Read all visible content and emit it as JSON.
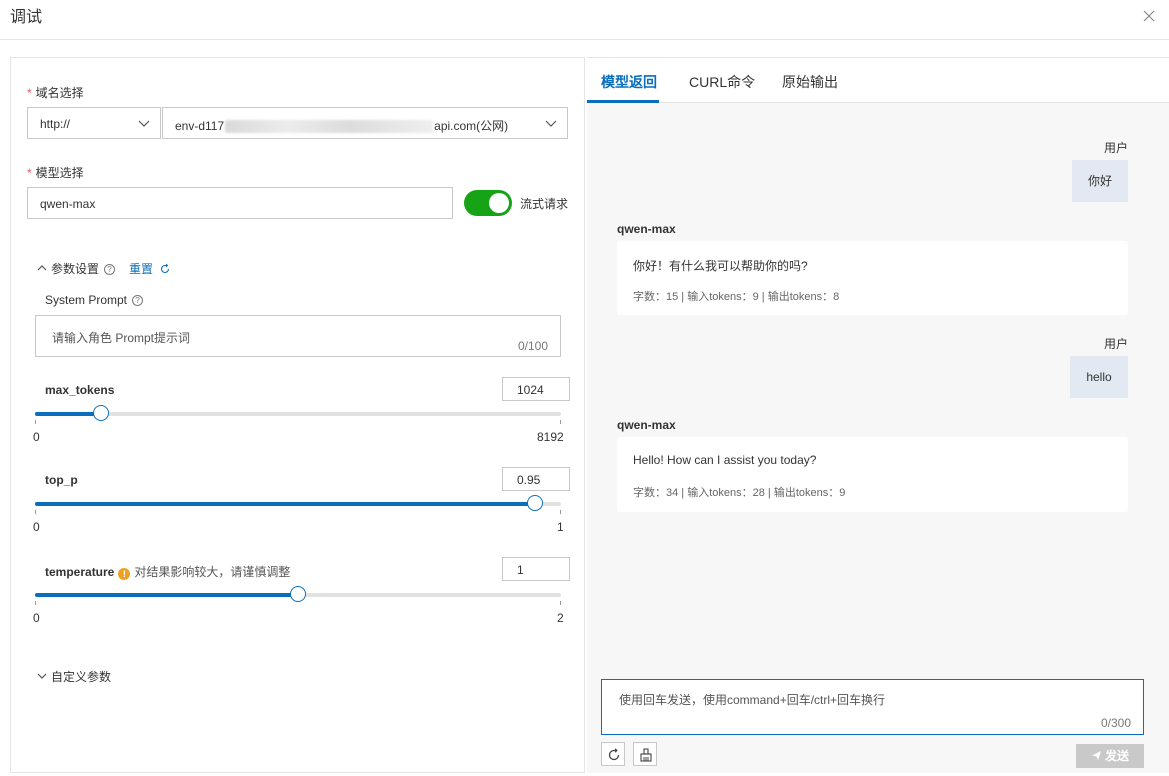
{
  "dialog": {
    "title": "调试"
  },
  "domain": {
    "label": "域名选择",
    "protocol": "http://",
    "env_prefix": "env-d117",
    "env_suffix": "api.com(公网)"
  },
  "model": {
    "label": "模型选择",
    "value": "qwen-max",
    "stream_label": "流式请求",
    "stream_on": true
  },
  "params": {
    "section_label": "参数设置",
    "reset_label": "重置",
    "system_prompt": {
      "label": "System Prompt",
      "placeholder": "请输入角色 Prompt提示词",
      "counter": "0/100"
    },
    "max_tokens": {
      "label": "max_tokens",
      "value": "1024",
      "min": "0",
      "max": "8192",
      "fraction": 0.125
    },
    "top_p": {
      "label": "top_p",
      "value": "0.95",
      "min": "0",
      "max": "1",
      "fraction": 0.95
    },
    "temperature": {
      "label": "temperature",
      "hint": "对结果影响较大，请谨慎调整",
      "value": "1",
      "min": "0",
      "max": "2",
      "fraction": 0.5
    },
    "custom_label": "自定义参数"
  },
  "tabs": [
    "模型返回",
    "CURL命令",
    "原始输出"
  ],
  "chat": {
    "user1": {
      "who": "用户",
      "text": "你好"
    },
    "bot1": {
      "who": "qwen-max",
      "text": "你好！有什么我可以帮助你的吗?",
      "meta": "字数：15 | 输入tokens：9 | 输出tokens：8"
    },
    "user2": {
      "who": "用户",
      "text": "hello"
    },
    "bot2": {
      "who": "qwen-max",
      "text": "Hello! How can I assist you today?",
      "meta": "字数：34 | 输入tokens：28 | 输出tokens：9"
    }
  },
  "composer": {
    "placeholder": "使用回车发送，使用command+回车/ctrl+回车换行",
    "counter": "0/300",
    "send_label": "发送"
  },
  "colors": {
    "accent": "#0a6ebd",
    "toggle_on": "#16a316",
    "warning": "#f0a020"
  }
}
